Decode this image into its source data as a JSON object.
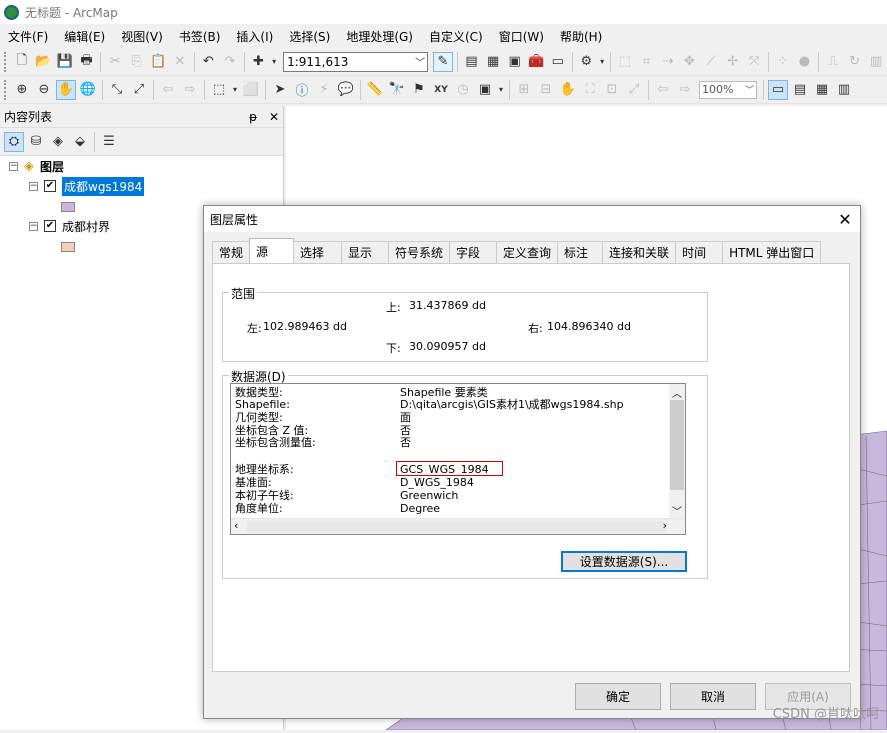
{
  "window": {
    "title": "无标题 - ArcMap"
  },
  "menu": [
    "文件(F)",
    "编辑(E)",
    "视图(V)",
    "书签(B)",
    "插入(I)",
    "选择(S)",
    "地理处理(G)",
    "自定义(C)",
    "窗口(W)",
    "帮助(H)"
  ],
  "toolbar": {
    "scale": "1:911,613",
    "zoom": "100%"
  },
  "toc": {
    "title": "内容列表",
    "pin_glyph": "ᵽ",
    "close_glyph": "✕",
    "root": "图层",
    "layers": [
      {
        "name": "成都wgs1984",
        "checked": true,
        "selected": true,
        "swatch_color": "#c8b6e0"
      },
      {
        "name": "成都村界",
        "checked": true,
        "selected": false,
        "swatch_color": "#f5cdb8"
      }
    ]
  },
  "map": {
    "fill_color": "#c9b8dd"
  },
  "dialog": {
    "title": "图层属性",
    "tabs": [
      "常规",
      "源",
      "选择",
      "显示",
      "符号系统",
      "字段",
      "定义查询",
      "标注",
      "连接和关联",
      "时间",
      "HTML 弹出窗口"
    ],
    "active_tab": "源",
    "extent": {
      "label": "范围",
      "top_label": "上:",
      "top": "31.437869 dd",
      "left_label": "左:",
      "left": "102.989463 dd",
      "right_label": "右:",
      "right": "104.896340 dd",
      "bottom_label": "下:",
      "bottom": "30.090957 dd"
    },
    "datasource": {
      "label": "数据源(D)",
      "rows": [
        {
          "key": "数据类型:",
          "value": "Shapefile 要素类"
        },
        {
          "key": "Shapefile:",
          "value": "D:\\qita\\arcgis\\GIS素材1\\成都wgs1984.shp"
        },
        {
          "key": "几何类型:",
          "value": "面"
        },
        {
          "key": "坐标包含 Z 值:",
          "value": "否"
        },
        {
          "key": "坐标包含测量值:",
          "value": "否"
        },
        {
          "key": "",
          "value": ""
        },
        {
          "key": "地理坐标系:",
          "value": "GCS_WGS_1984"
        },
        {
          "key": "基准面:",
          "value": "D_WGS_1984"
        },
        {
          "key": "本初子午线:",
          "value": "Greenwich"
        },
        {
          "key": "角度单位:",
          "value": "Degree"
        }
      ],
      "set_button": "设置数据源(S)..."
    },
    "buttons": {
      "ok": "确定",
      "cancel": "取消",
      "apply": "应用(A)"
    }
  },
  "watermark": "CSDN @肖呔呔呵"
}
